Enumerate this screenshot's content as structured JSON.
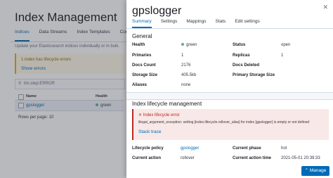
{
  "background": {
    "title": "Index Management",
    "tabs": [
      "Indices",
      "Data Streams",
      "Index Templates",
      "Compo"
    ],
    "description": "Update your Elasticsearch indices individually or in bulk.",
    "callout": {
      "text": "1 index has lifecycle errors",
      "link": "Show errors"
    },
    "search": {
      "value": "ilm.step:ERROR"
    },
    "table": {
      "headers": {
        "name": "Name",
        "health": "Health"
      },
      "row": {
        "name": "gpslogger",
        "health": "green"
      }
    },
    "rows_per_page": "Rows per page: 10"
  },
  "flyout": {
    "title": "gpslogger",
    "tabs": [
      "Summary",
      "Settings",
      "Mappings",
      "Stats",
      "Edit settings"
    ],
    "general": {
      "heading": "General",
      "left": [
        {
          "key": "Health",
          "value": "green"
        },
        {
          "key": "Primaries",
          "value": "1"
        },
        {
          "key": "Docs Count",
          "value": "2176"
        },
        {
          "key": "Storage Size",
          "value": "405.5kb"
        },
        {
          "key": "Aliases",
          "value": "none"
        }
      ],
      "right": [
        {
          "key": "Status",
          "value": "open"
        },
        {
          "key": "Replicas",
          "value": "1"
        },
        {
          "key": "Docs Deleted",
          "value": ""
        },
        {
          "key": "Primary Storage Size",
          "value": ""
        }
      ]
    },
    "ilm": {
      "heading": "Index lifecycle management",
      "error_title": "Index lifecycle error",
      "error_detail": "illegal_argument_exception: setting [index.lifecycle.rollover_alias] for index [gpslogger] is empty or not defined",
      "stack_trace": "Stack trace",
      "lifecycle_policy": {
        "key": "Lifecycle policy",
        "value": "gpslogger"
      },
      "current_phase": {
        "key": "Current phase",
        "value": "hot"
      },
      "current_action": {
        "key": "Current action",
        "value": "rollover"
      },
      "current_action_time": {
        "key": "Current action time",
        "value": "2021-05-01 20:39:33"
      }
    },
    "manage_button": "Manage"
  },
  "colors": {
    "accent": "#006bb8",
    "health_green": "#54b399",
    "error": "#bd271e",
    "warning": "#f5a700"
  }
}
